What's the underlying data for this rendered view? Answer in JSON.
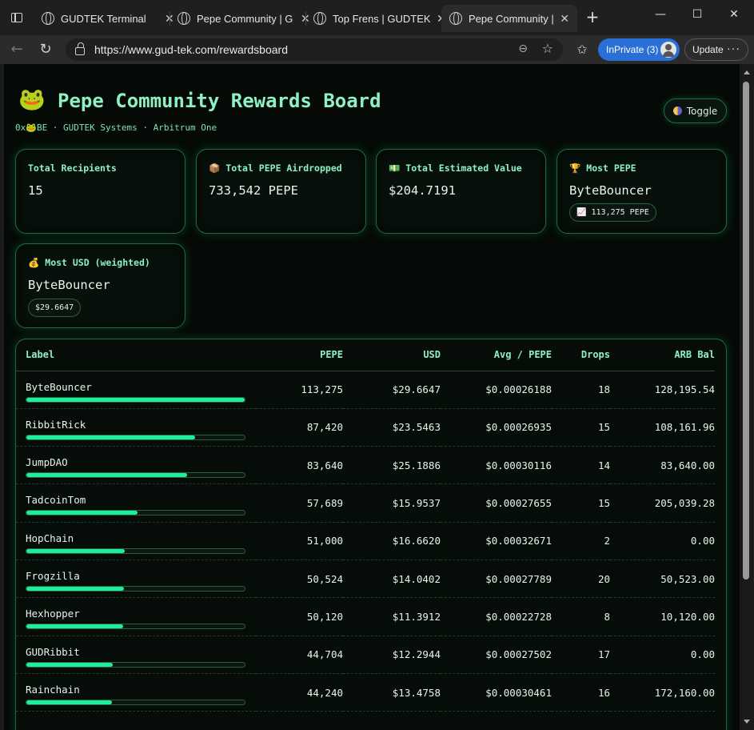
{
  "browser": {
    "tabs": [
      {
        "title": "GUDTEK Terminal",
        "active": false
      },
      {
        "title": "Pepe Community | G",
        "active": false
      },
      {
        "title": "Top Frens | GUDTEK",
        "active": false
      },
      {
        "title": "Pepe Community | G",
        "active": true
      }
    ],
    "url": "https://www.gud-tek.com/rewardsboard",
    "inprivate_label": "InPrivate (3)",
    "update_label": "Update"
  },
  "header": {
    "icon": "🐸",
    "title": "Pepe Community Rewards Board",
    "subtitle": "0x🐸BE · GUDTEK Systems · Arbitrum One",
    "toggle_label": "Toggle"
  },
  "cards": {
    "recipients": {
      "label": "Total Recipients",
      "value": "15"
    },
    "airdropped": {
      "icon": "📦",
      "label": "Total PEPE Airdropped",
      "value": "733,542 PEPE"
    },
    "est_value": {
      "icon": "💵",
      "label": "Total Estimated Value",
      "value": "$204.7191"
    },
    "most_pepe": {
      "icon": "🏆",
      "label": "Most PEPE",
      "value": "ByteBouncer",
      "pill_icon": "📈",
      "pill": "113,275 PEPE"
    },
    "most_usd": {
      "icon": "💰",
      "label": "Most USD (weighted)",
      "value": "ByteBouncer",
      "pill": "$29.6647"
    }
  },
  "table": {
    "headers": {
      "label": "Label",
      "pepe": "PEPE",
      "usd": "USD",
      "avg": "Avg / PEPE",
      "drops": "Drops",
      "arb": "ARB Bal"
    },
    "rows": [
      {
        "label": "ByteBouncer",
        "pepe": "113,275",
        "usd": "$29.6647",
        "avg": "$0.00026188",
        "drops": "18",
        "arb": "128,195.54",
        "share": 1.0
      },
      {
        "label": "RibbitRick",
        "pepe": "87,420",
        "usd": "$23.5463",
        "avg": "$0.00026935",
        "drops": "15",
        "arb": "108,161.96",
        "share": 0.772
      },
      {
        "label": "JumpDAO",
        "pepe": "83,640",
        "usd": "$25.1886",
        "avg": "$0.00030116",
        "drops": "14",
        "arb": "83,640.00",
        "share": 0.738
      },
      {
        "label": "TadcoinTom",
        "pepe": "57,689",
        "usd": "$15.9537",
        "avg": "$0.00027655",
        "drops": "15",
        "arb": "205,039.28",
        "share": 0.509
      },
      {
        "label": "HopChain",
        "pepe": "51,000",
        "usd": "$16.6620",
        "avg": "$0.00032671",
        "drops": "2",
        "arb": "0.00",
        "share": 0.45
      },
      {
        "label": "Frogzilla",
        "pepe": "50,524",
        "usd": "$14.0402",
        "avg": "$0.00027789",
        "drops": "20",
        "arb": "50,523.00",
        "share": 0.446
      },
      {
        "label": "Hexhopper",
        "pepe": "50,120",
        "usd": "$11.3912",
        "avg": "$0.00022728",
        "drops": "8",
        "arb": "10,120.00",
        "share": 0.442
      },
      {
        "label": "GUDRibbit",
        "pepe": "44,704",
        "usd": "$12.2944",
        "avg": "$0.00027502",
        "drops": "17",
        "arb": "0.00",
        "share": 0.395
      },
      {
        "label": "Rainchain",
        "pepe": "44,240",
        "usd": "$13.4758",
        "avg": "$0.00030461",
        "drops": "16",
        "arb": "172,160.00",
        "share": 0.391
      }
    ]
  }
}
